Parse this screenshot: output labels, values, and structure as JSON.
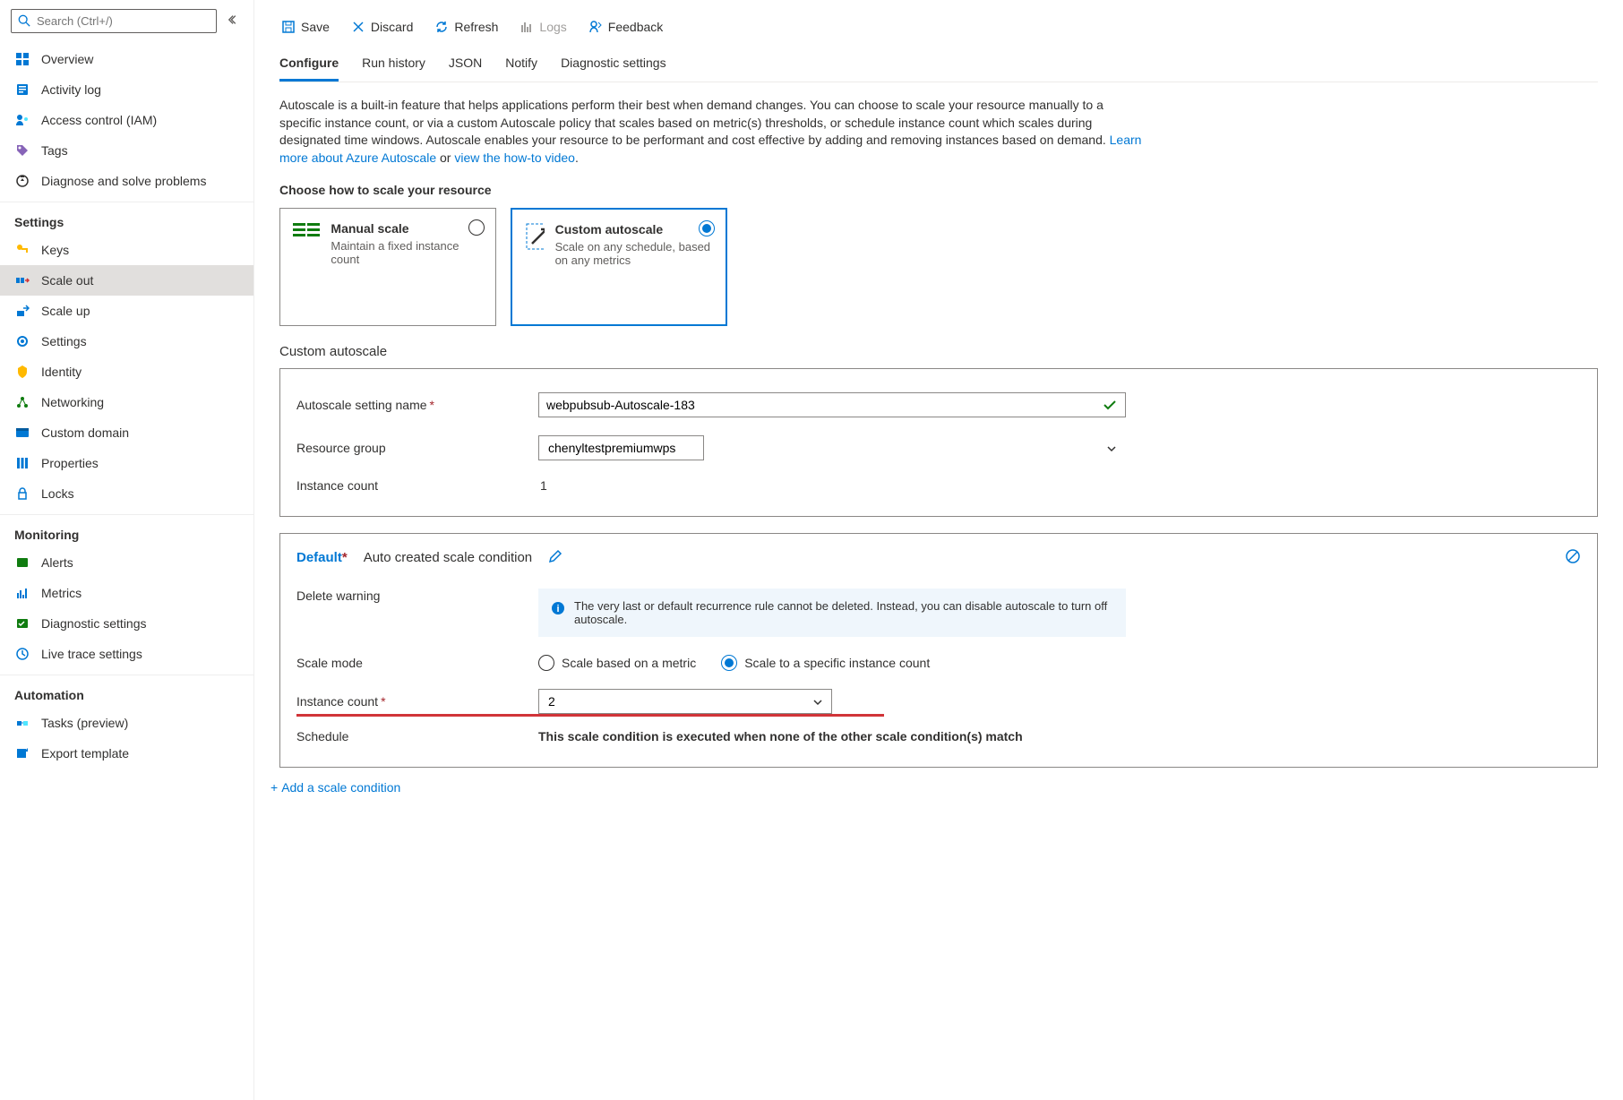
{
  "search": {
    "placeholder": "Search (Ctrl+/)"
  },
  "nav": {
    "items": [
      {
        "label": "Overview",
        "icon": "overview"
      },
      {
        "label": "Activity log",
        "icon": "activity"
      },
      {
        "label": "Access control (IAM)",
        "icon": "iam"
      },
      {
        "label": "Tags",
        "icon": "tags"
      },
      {
        "label": "Diagnose and solve problems",
        "icon": "diagnose"
      }
    ],
    "settings_label": "Settings",
    "settings": [
      {
        "label": "Keys",
        "icon": "keys"
      },
      {
        "label": "Scale out",
        "icon": "scaleout"
      },
      {
        "label": "Scale up",
        "icon": "scaleup"
      },
      {
        "label": "Settings",
        "icon": "gear"
      },
      {
        "label": "Identity",
        "icon": "identity"
      },
      {
        "label": "Networking",
        "icon": "networking"
      },
      {
        "label": "Custom domain",
        "icon": "domain"
      },
      {
        "label": "Properties",
        "icon": "properties"
      },
      {
        "label": "Locks",
        "icon": "locks"
      }
    ],
    "monitoring_label": "Monitoring",
    "monitoring": [
      {
        "label": "Alerts",
        "icon": "alerts"
      },
      {
        "label": "Metrics",
        "icon": "metrics"
      },
      {
        "label": "Diagnostic settings",
        "icon": "diagsettings"
      },
      {
        "label": "Live trace settings",
        "icon": "livetrace"
      }
    ],
    "automation_label": "Automation",
    "automation": [
      {
        "label": "Tasks (preview)",
        "icon": "tasks"
      },
      {
        "label": "Export template",
        "icon": "export"
      }
    ]
  },
  "toolbar": {
    "save": "Save",
    "discard": "Discard",
    "refresh": "Refresh",
    "logs": "Logs",
    "feedback": "Feedback"
  },
  "tabs": {
    "configure": "Configure",
    "run_history": "Run history",
    "json": "JSON",
    "notify": "Notify",
    "diag": "Diagnostic settings"
  },
  "desc": {
    "text": "Autoscale is a built-in feature that helps applications perform their best when demand changes. You can choose to scale your resource manually to a specific instance count, or via a custom Autoscale policy that scales based on metric(s) thresholds, or schedule instance count which scales during designated time windows. Autoscale enables your resource to be performant and cost effective by adding and removing instances based on demand. ",
    "link1": "Learn more about Azure Autoscale",
    "or": " or ",
    "link2": "view the how-to video"
  },
  "choose_title": "Choose how to scale your resource",
  "cards": {
    "manual": {
      "title": "Manual scale",
      "desc": "Maintain a fixed instance count"
    },
    "custom": {
      "title": "Custom autoscale",
      "desc": "Scale on any schedule, based on any metrics"
    }
  },
  "custom_title": "Custom autoscale",
  "form": {
    "setting_name_label": "Autoscale setting name",
    "setting_name_value": "webpubsub-Autoscale-183",
    "rg_label": "Resource group",
    "rg_value": "chenyltestpremiumwps",
    "instance_count_label": "Instance count",
    "instance_count_value": "1"
  },
  "condition": {
    "default_label": "Default",
    "name": "Auto created scale condition",
    "delete_warning_label": "Delete warning",
    "delete_warning_text": "The very last or default recurrence rule cannot be deleted. Instead, you can disable autoscale to turn off autoscale.",
    "scale_mode_label": "Scale mode",
    "mode_metric": "Scale based on a metric",
    "mode_specific": "Scale to a specific instance count",
    "instance_count_label": "Instance count",
    "instance_count_value": "2",
    "schedule_label": "Schedule",
    "schedule_text": "This scale condition is executed when none of the other scale condition(s) match"
  },
  "add_link": "Add a scale condition"
}
